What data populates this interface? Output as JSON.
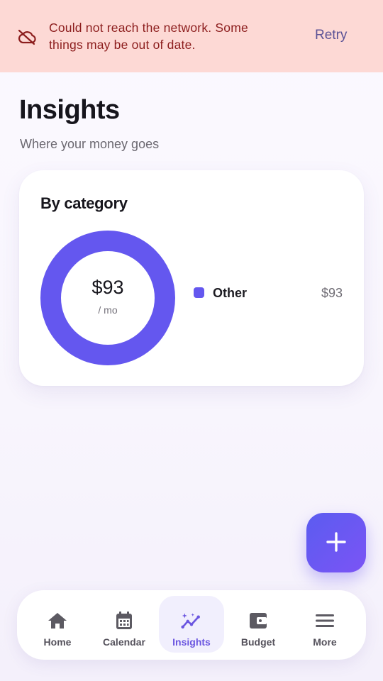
{
  "banner": {
    "icon": "cloud-off-icon",
    "message": "Could not reach the network. Some things may be out of date.",
    "retry_label": "Retry",
    "bg_color": "#fdd9d5",
    "text_color": "#8c1d1d"
  },
  "page": {
    "title": "Insights",
    "subtitle": "Where your money goes"
  },
  "category_card": {
    "title": "By category",
    "total": "$93",
    "period": "/ mo",
    "items": [
      {
        "label": "Other",
        "amount": "$93",
        "share": 1.0,
        "color": "#6457ef"
      }
    ]
  },
  "fab": {
    "icon": "plus-icon"
  },
  "nav": {
    "items": [
      {
        "label": "Home",
        "icon": "home-icon",
        "active": false
      },
      {
        "label": "Calendar",
        "icon": "calendar-icon",
        "active": false
      },
      {
        "label": "Insights",
        "icon": "insights-sparkle-icon",
        "active": true
      },
      {
        "label": "Budget",
        "icon": "wallet-icon",
        "active": false
      },
      {
        "label": "More",
        "icon": "menu-icon",
        "active": false
      }
    ],
    "accent_color": "#6b56e0"
  }
}
